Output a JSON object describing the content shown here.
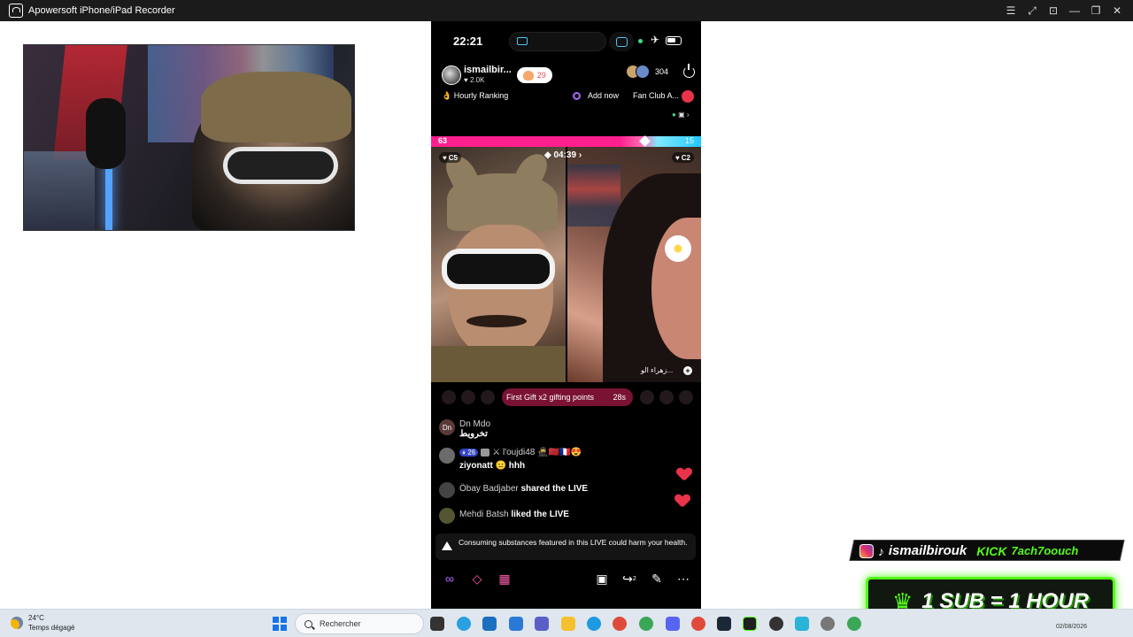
{
  "window": {
    "title": "Apowersoft iPhone/iPad Recorder",
    "controls": [
      "☰",
      "⤢",
      "⊡",
      "—",
      "❐",
      "✕"
    ]
  },
  "phone": {
    "status": {
      "time": "22:21"
    },
    "host": {
      "name": "ismailbir...",
      "likes": "2.0K",
      "follow_count": "29"
    },
    "viewer_count": "304",
    "subbar": {
      "hourly_ranking": "👌 Hourly Ranking",
      "add_now": "Add now",
      "fan_club": "Fan Club A..."
    },
    "battle": {
      "left_score": "63",
      "right_score": "15",
      "timer": "04:39"
    },
    "tags": {
      "left": "C5",
      "right": "C2"
    },
    "remote_name": "زهراء الو...",
    "gift_banner": {
      "text": "First Gift x2 gifting points",
      "seconds": "28s"
    },
    "chat": [
      {
        "avatar": "Dn",
        "user": "Dn Mdo",
        "text": "تخرويط"
      },
      {
        "badge": "26",
        "user": "l'oujdi48",
        "text": "ziyonatt 😐 hhh"
      },
      {
        "user": "Öbay Badjaber",
        "text": "shared the LIVE"
      },
      {
        "user": "Mehdi Batsh",
        "text": "liked the LIVE"
      }
    ],
    "warning": "Consuming substances featured in this LIVE could harm your health.",
    "toolbar": {
      "icons": [
        "link-icon",
        "gift-multi-icon",
        "apps-icon",
        "film-icon",
        "share-icon",
        "wand-icon",
        "more-icon"
      ],
      "share_count": "2"
    }
  },
  "overlay": {
    "social_handle": "ismailbirouk",
    "kick_label": "KICK",
    "kick_handle": "7ach7oouch",
    "sub_text": "1 SUB = 1 HOUR"
  },
  "taskbar": {
    "temp": "24°C",
    "weather": "Temps dégagé",
    "search_placeholder": "Rechercher",
    "date": "02/08/2026"
  },
  "colors": {
    "accent_pink": "#ff1f8e",
    "accent_cyan": "#23c8ff",
    "kick_green": "#53fc18"
  }
}
